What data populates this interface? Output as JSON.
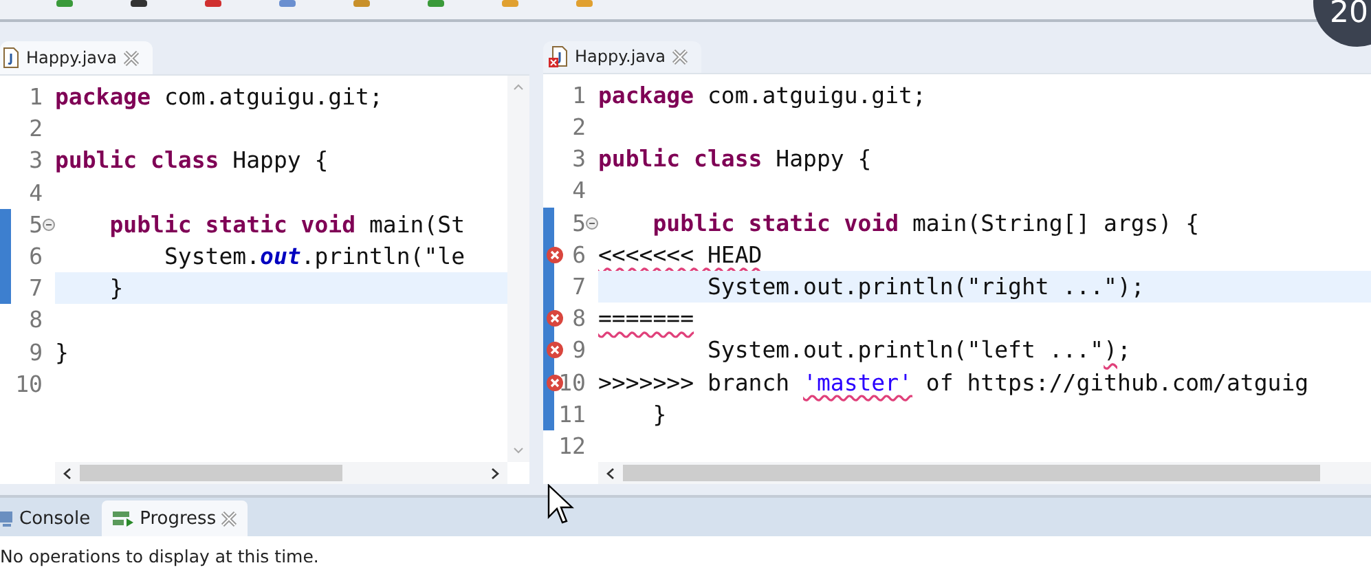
{
  "toolbar": {
    "badge": "20"
  },
  "editors": [
    {
      "tab": {
        "title": "Happy.java",
        "error": false
      },
      "vscroll": true,
      "lines": [
        {
          "number": "1",
          "error": false,
          "fold": false,
          "changed": false,
          "current": false,
          "segments": [
            {
              "kind": "kw",
              "text": "package"
            },
            {
              "kind": "text",
              "text": " com.atguigu.git;"
            }
          ]
        },
        {
          "number": "2",
          "error": false,
          "fold": false,
          "changed": false,
          "current": false
        },
        {
          "number": "3",
          "error": false,
          "fold": false,
          "changed": false,
          "current": false,
          "segments": [
            {
              "kind": "kw",
              "text": "public class"
            },
            {
              "kind": "text",
              "text": " Happy {"
            }
          ]
        },
        {
          "number": "4",
          "error": false,
          "fold": false,
          "changed": false,
          "current": false
        },
        {
          "number": "5",
          "error": false,
          "fold": true,
          "changed": true,
          "current": false,
          "segments": [
            {
              "kind": "kw",
              "text": "    public static void"
            },
            {
              "kind": "text",
              "text": " main(St"
            }
          ]
        },
        {
          "number": "6",
          "error": false,
          "fold": false,
          "changed": true,
          "current": false,
          "segments": [
            {
              "kind": "text",
              "text": "        System."
            },
            {
              "kind": "field",
              "text": "out"
            },
            {
              "kind": "text",
              "text": ".println(\"le"
            }
          ]
        },
        {
          "number": "7",
          "error": false,
          "fold": false,
          "changed": true,
          "current": true,
          "segments": [
            {
              "kind": "text",
              "text": "    }"
            }
          ]
        },
        {
          "number": "8",
          "error": false,
          "fold": false,
          "changed": false,
          "current": false
        },
        {
          "number": "9",
          "error": false,
          "fold": false,
          "changed": false,
          "current": false,
          "segments": [
            {
              "kind": "text",
              "text": "}"
            }
          ]
        },
        {
          "number": "10",
          "error": false,
          "fold": false,
          "changed": false,
          "current": false
        }
      ]
    },
    {
      "tab": {
        "title": "Happy.java",
        "error": true
      },
      "vscroll": false,
      "lines": [
        {
          "number": "1",
          "error": false,
          "fold": false,
          "changed": false,
          "current": false,
          "segments": [
            {
              "kind": "kw",
              "text": "package"
            },
            {
              "kind": "text",
              "text": " com.atguigu.git;"
            }
          ]
        },
        {
          "number": "2",
          "error": false,
          "fold": false,
          "changed": false,
          "current": false
        },
        {
          "number": "3",
          "error": false,
          "fold": false,
          "changed": false,
          "current": false,
          "segments": [
            {
              "kind": "kw",
              "text": "public class"
            },
            {
              "kind": "text",
              "text": " Happy {"
            }
          ]
        },
        {
          "number": "4",
          "error": false,
          "fold": false,
          "changed": false,
          "current": false
        },
        {
          "number": "5",
          "error": false,
          "fold": true,
          "changed": true,
          "current": false,
          "segments": [
            {
              "kind": "kw",
              "text": "    public static void"
            },
            {
              "kind": "text",
              "text": " main(String[] args) {"
            }
          ]
        },
        {
          "number": "6",
          "error": true,
          "fold": false,
          "changed": true,
          "current": false,
          "segments": [
            {
              "kind": "err",
              "text": "<<<<<<< HEAD"
            }
          ]
        },
        {
          "number": "7",
          "error": false,
          "fold": false,
          "changed": true,
          "current": true,
          "segments": [
            {
              "kind": "text",
              "text": "        System.out.println(\"right ...\");"
            }
          ]
        },
        {
          "number": "8",
          "error": true,
          "fold": false,
          "changed": true,
          "current": false,
          "segments": [
            {
              "kind": "err",
              "text": "======="
            }
          ]
        },
        {
          "number": "9",
          "error": true,
          "fold": false,
          "changed": true,
          "current": false,
          "segments": [
            {
              "kind": "text",
              "text": "        System.out.println(\"left ...\""
            },
            {
              "kind": "err",
              "text": ")"
            },
            {
              "kind": "text",
              "text": ";"
            }
          ]
        },
        {
          "number": "10",
          "error": true,
          "fold": false,
          "changed": true,
          "current": false,
          "segments": [
            {
              "kind": "text",
              "text": ">>>>>>> branch "
            },
            {
              "kind": "errstr",
              "text": "'master'"
            },
            {
              "kind": "text",
              "text": " of https://github.com/atguig"
            }
          ]
        },
        {
          "number": "11",
          "error": false,
          "fold": false,
          "changed": true,
          "current": false,
          "segments": [
            {
              "kind": "text",
              "text": "    }"
            }
          ]
        },
        {
          "number": "12",
          "error": false,
          "fold": false,
          "changed": false,
          "current": false
        }
      ]
    }
  ],
  "bottom_panel": {
    "tabs": [
      {
        "label": "Console",
        "selected": false,
        "closable": false
      },
      {
        "label": "Progress",
        "selected": true,
        "closable": true
      }
    ],
    "message": "No operations to display at this time."
  }
}
